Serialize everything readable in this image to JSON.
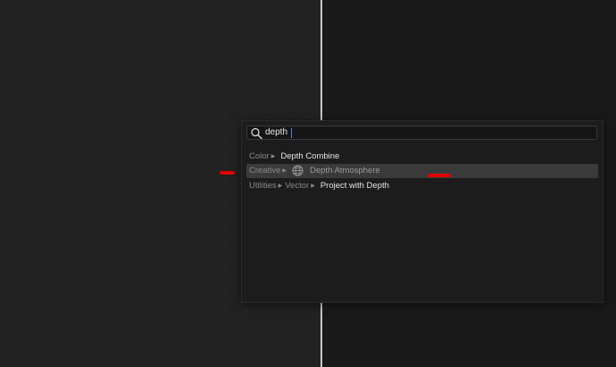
{
  "search": {
    "value": "depth"
  },
  "results": [
    {
      "crumbs": [
        "Color"
      ],
      "name": "Depth Combine",
      "icon": null,
      "selected": false
    },
    {
      "crumbs": [
        "Creative"
      ],
      "name": "Depth Atmosphere",
      "icon": "globe-icon",
      "selected": true
    },
    {
      "crumbs": [
        "Utilities",
        "Vector"
      ],
      "name": "Project with Depth",
      "icon": null,
      "selected": false
    }
  ],
  "colors": {
    "left_panel": "#222222",
    "right_panel": "#191919",
    "popup": "#1c1c1c",
    "selection": "#3a3a3a",
    "annotation": "#e00000"
  }
}
